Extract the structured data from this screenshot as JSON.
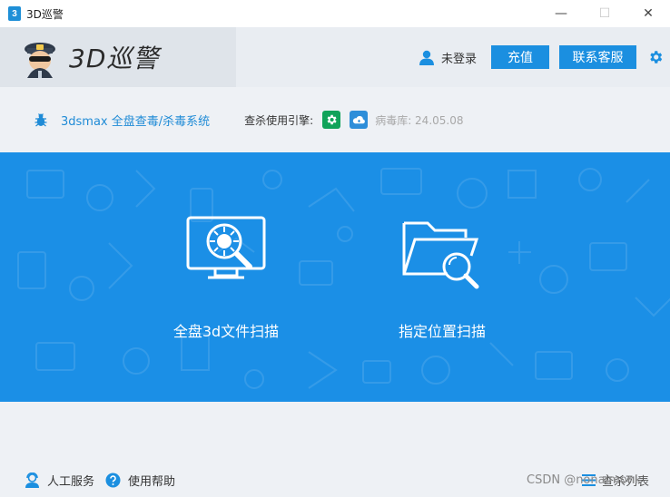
{
  "window": {
    "app_icon_glyph": "3",
    "title": "3D巡警",
    "minimize": "—",
    "maximize": "☐",
    "close": "✕"
  },
  "header": {
    "brand": "3D巡警",
    "login_status": "未登录",
    "recharge_label": "充值",
    "service_label": "联系客服"
  },
  "info": {
    "system_title": "3dsmax 全盘查毒/杀毒系统",
    "engine_label": "查杀使用引擎:",
    "db_label": "病毒库: 24.05.08"
  },
  "scan": {
    "full_label": "全盘3d文件扫描",
    "custom_label": "指定位置扫描"
  },
  "footer": {
    "manual_service": "人工服务",
    "help": "使用帮助",
    "watermark": "CSDN @nonaimonk",
    "kill_list": "查杀列表"
  },
  "colors": {
    "accent": "#1b8fe0",
    "main_bg": "#1b8fe6",
    "link_text": "#1f8bd6",
    "engine_green": "#11a35a"
  },
  "icons": {
    "mascot": "police-mascot-icon",
    "user": "user-icon",
    "settings": "gear-icon",
    "bug": "bug-icon",
    "engine_a": "engine-gear-icon",
    "engine_b": "cloud-engine-icon",
    "full_scan": "monitor-virus-scan-icon",
    "custom_scan": "folder-search-icon",
    "manual": "support-agent-icon",
    "help": "question-icon",
    "list": "list-icon"
  }
}
